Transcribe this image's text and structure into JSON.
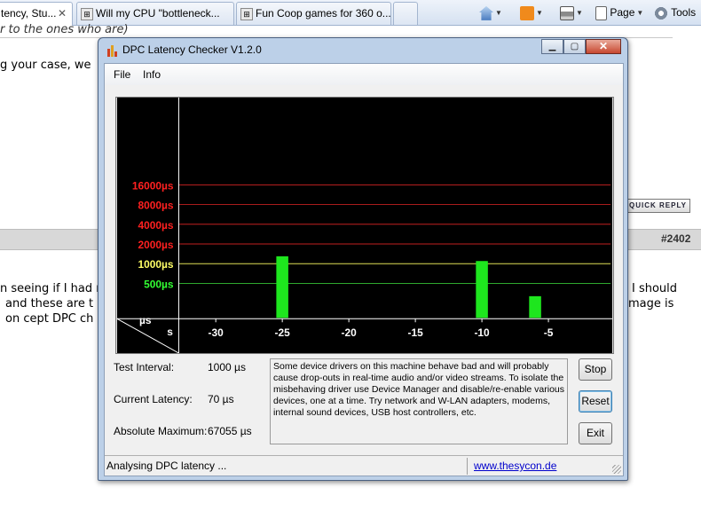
{
  "browser": {
    "tabs": [
      {
        "label": "tency, Stu..."
      },
      {
        "label": "Will my CPU \"bottleneck..."
      },
      {
        "label": "Fun Coop games for 360 o..."
      }
    ],
    "toolbar": {
      "page_label": "Page",
      "tools_label": "Tools"
    },
    "page": {
      "line1": "r to the ones who are)",
      "line2": "g your case, we",
      "quick_reply": "QUICK REPLY",
      "post_number": "#2402",
      "left_lines": [
        "n seeing if I had r",
        "and these are t",
        "on cept DPC ch"
      ],
      "right_lines": [
        "I should",
        "mage is"
      ]
    }
  },
  "window": {
    "title": "DPC Latency Checker V1.2.0",
    "menu": [
      "File",
      "Info"
    ],
    "chart_data": {
      "type": "bar",
      "ylabels": [
        "16000µs",
        "8000µs",
        "4000µs",
        "2000µs",
        "1000µs",
        "500µs"
      ],
      "ylabel_colors": [
        "#ff2020",
        "#ff2020",
        "#ff2020",
        "#ff2020",
        "#ffff66",
        "#33ff33"
      ],
      "line_colors": [
        "#c02020",
        "#c02020",
        "#c02020",
        "#c02020",
        "#dddd55",
        "#2ea82e"
      ],
      "xlabels": [
        "-30",
        "-25",
        "-20",
        "-15",
        "-10",
        "-5"
      ],
      "xticks": [
        -30,
        -25,
        -20,
        -15,
        -10,
        -5
      ],
      "x_range": [
        -33,
        -1
      ],
      "unit_y": "µs",
      "unit_x": "s",
      "bars": [
        {
          "t": -33,
          "us": 70
        },
        {
          "t": -32,
          "us": 75
        },
        {
          "t": -31,
          "us": 75
        },
        {
          "t": -30,
          "us": 75
        },
        {
          "t": -29,
          "us": 70
        },
        {
          "t": -28,
          "us": 75
        },
        {
          "t": -27,
          "us": 70
        },
        {
          "t": -26,
          "us": 70
        },
        {
          "t": -25,
          "us": 1300
        },
        {
          "t": -24,
          "us": 75
        },
        {
          "t": -23,
          "us": 70
        },
        {
          "t": -22,
          "us": 80
        },
        {
          "t": -21,
          "us": 80
        },
        {
          "t": -20,
          "us": 115
        },
        {
          "t": -19,
          "us": 75
        },
        {
          "t": -18,
          "us": 75
        },
        {
          "t": -17,
          "us": 90
        },
        {
          "t": -16,
          "us": 95
        },
        {
          "t": -15,
          "us": 80
        },
        {
          "t": -14,
          "us": 75
        },
        {
          "t": -13,
          "us": 75
        },
        {
          "t": -12,
          "us": 75
        },
        {
          "t": -11,
          "us": 70
        },
        {
          "t": -10,
          "us": 1100
        },
        {
          "t": -9,
          "us": 75
        },
        {
          "t": -8,
          "us": 75
        },
        {
          "t": -7,
          "us": 75
        },
        {
          "t": -6,
          "us": 320
        },
        {
          "t": -5,
          "us": 70
        },
        {
          "t": -4,
          "us": 75
        },
        {
          "t": -3,
          "us": 95
        },
        {
          "t": -2,
          "us": 70
        },
        {
          "t": -1,
          "us": 80
        }
      ],
      "colors": {
        "bar": "#1ee61e",
        "background": "#000000"
      }
    },
    "stats": {
      "test_interval_label": "Test Interval:",
      "test_interval_value": "1000 µs",
      "current_latency_label": "Current Latency:",
      "current_latency_value": "70 µs",
      "absolute_max_label": "Absolute Maximum:",
      "absolute_max_value": "67055 µs"
    },
    "description": "Some device drivers on this machine behave bad and will probably cause drop-outs in real-time audio and/or video streams. To isolate the misbehaving driver use Device Manager and disable/re-enable various devices, one at a time. Try network and W-LAN adapters, modems, internal sound devices, USB host controllers, etc.",
    "buttons": {
      "stop": "Stop",
      "reset": "Reset",
      "exit": "Exit"
    },
    "status": {
      "text": "Analysing DPC latency ...",
      "link": "www.thesycon.de"
    }
  }
}
